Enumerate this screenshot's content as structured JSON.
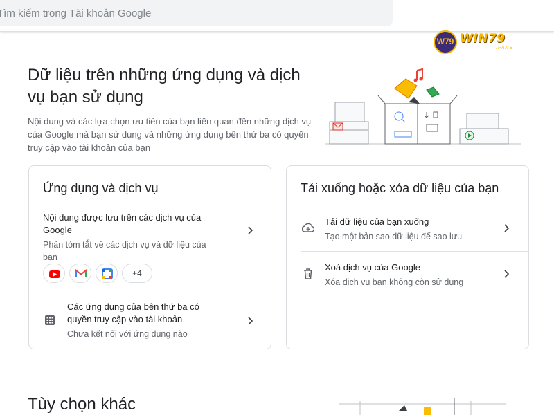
{
  "search": {
    "placeholder": "Tìm kiếm trong Tài khoản Google"
  },
  "brand": {
    "badge": "W79",
    "name": "WIN79",
    "sub": ".FANS"
  },
  "hero": {
    "title": "Dữ liệu trên những ứng dụng và dịch vụ bạn sử dụng",
    "description": "Nội dung và các lựa chọn ưu tiên của bạn liên quan đến những dịch vụ của Google mà bạn sử dụng và những ứng dụng bên thứ ba có quyền truy cập vào tài khoản của bạn"
  },
  "apps_card": {
    "title": "Ứng dụng và dịch vụ",
    "content": {
      "title": "Nội dung được lưu trên các dịch vụ của Google",
      "subtitle": "Phần tóm tắt về các dịch vụ và dữ liệu của bạn"
    },
    "chips": [
      {
        "icon": "youtube-icon",
        "color": "#ff0000"
      },
      {
        "icon": "gmail-icon",
        "color": "#ea4335"
      },
      {
        "icon": "google-calendar-icon",
        "color": "#4285f4"
      }
    ],
    "more_chip": "+4",
    "third_party": {
      "title": "Các ứng dụng của bên thứ ba có quyền truy cập vào tài khoản",
      "subtitle": "Chưa kết nối với ứng dụng nào"
    }
  },
  "download_card": {
    "title": "Tải xuống hoặc xóa dữ liệu của bạn",
    "download": {
      "title": "Tải dữ liệu của bạn xuống",
      "subtitle": "Tạo một bản sao dữ liệu để sao lưu"
    },
    "delete": {
      "title": "Xoá dịch vụ của Google",
      "subtitle": "Xóa dịch vụ bạn không còn sử dụng"
    }
  },
  "more_options": {
    "title": "Tùy chọn khác"
  },
  "colors": {
    "text_primary": "#202124",
    "text_secondary": "#5f6368",
    "border": "#dadce0",
    "brand_gold": "#f5b800"
  }
}
